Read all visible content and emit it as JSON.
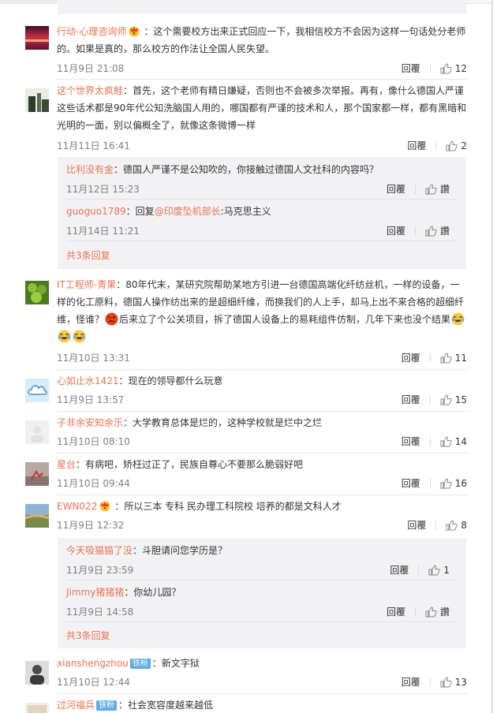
{
  "comments": [
    {
      "user": "行动-心理咨询师",
      "text_part1": "：这个需要校方出来正式回应一下，我相信校方不会因为这样一句话处分老师",
      "text_part2": "的。如果是真的，那么校方的作法让全国人民失望。",
      "time": "11月9日 21:08",
      "reply_label": "回覆",
      "likes": "12"
    },
    {
      "user": "这个世界太疯鲑",
      "text_part1": "：首先，这个老师有精日嫌疑，否则也不会被多次举报。再有，像什么德国人严谨",
      "text_part2": "这些话术都是90年代公知洗脑国人用的，哪国都有严谨的技术和人，那个国家都一样，都有黑暗和",
      "text_part3": "光明的一面，别以偏概全了，就像这条微博一样",
      "time": "11月11日 16:41",
      "reply_label": "回覆",
      "likes": "2",
      "replies": [
        {
          "user": "比利没有金",
          "text": "：德国人严谨不是公知吹的，你接触过德国人文社科的内容吗？",
          "time": "11月12日 15:23",
          "reply_label": "回覆",
          "likes": "讚"
        },
        {
          "user": "guoguo1789",
          "text_prefix": "：回复",
          "mention": "@印度坠机部长",
          "text": ":马克思主义",
          "time": "11月14日 11:21",
          "reply_label": "回覆",
          "likes": "讚"
        }
      ],
      "more_label": "共3条回复"
    },
    {
      "user": "IT工程师-青果",
      "text_part1": "：80年代末，某研究院帮助某地方引进一台德国高端化纤纺丝机，一样的设备，一",
      "text_part2": "样的化工原料，德国人操作纺出来的是超细纤维，而换我们的人上手，却马上出不来合格的超细纤",
      "text_part3a": "维，怪谁？",
      "text_part3b": "后来立了个公关项目，拆了德国人设备上的易耗组件仿制，几年下来也没个结果",
      "time": "11月10日 13:31",
      "reply_label": "回覆",
      "likes": "11"
    },
    {
      "user": "心如止水1421",
      "text": "：现在的领导都什么玩意",
      "time": "11月9日 13:57",
      "reply_label": "回覆",
      "likes": "15"
    },
    {
      "user": "子非余安知余乐",
      "text": "：大学教育总体是烂的，这种学校就是烂中之烂",
      "time": "11月10日 08:10",
      "reply_label": "回覆",
      "likes": "14"
    },
    {
      "user": "星台",
      "text": "：有病吧，矫枉过正了，民族自尊心不要那么脆弱好吧",
      "time": "11月10日 09:44",
      "reply_label": "回覆",
      "likes": "16"
    },
    {
      "user": "EWN022",
      "text": "：所以三本 专科  民办理工科院校 培养的都是文科人才",
      "time": "11月9日 12:32",
      "reply_label": "回覆",
      "likes": "8",
      "replies": [
        {
          "user": "今天吸猫猫了没",
          "text": "：斗胆请问您学历是？",
          "time": "11月9日 23:59",
          "reply_label": "回覆",
          "likes": "1"
        },
        {
          "user": "Jimmy猪猪猪",
          "text": "：你幼儿园？",
          "time": "11月9日 14:58",
          "reply_label": "回覆",
          "likes": "讚"
        }
      ],
      "more_label": "共3条回复"
    },
    {
      "user": "xianshengzhou",
      "badge": "铁粉",
      "text": "：新文字狱",
      "time": "11月10日 12:44",
      "reply_label": "回覆",
      "likes": "13"
    },
    {
      "user": "过河福兵",
      "badge": "铁粉",
      "text": "：社会宽容度越来越低"
    }
  ],
  "colors": {
    "username": "#eb7350",
    "reply_bg": "#f2f2f5",
    "badge": "#5ea9e5"
  },
  "icons": [
    "thumb-up-icon",
    "crown-icon",
    "angry-face-icon",
    "laughing-tears-icon"
  ]
}
